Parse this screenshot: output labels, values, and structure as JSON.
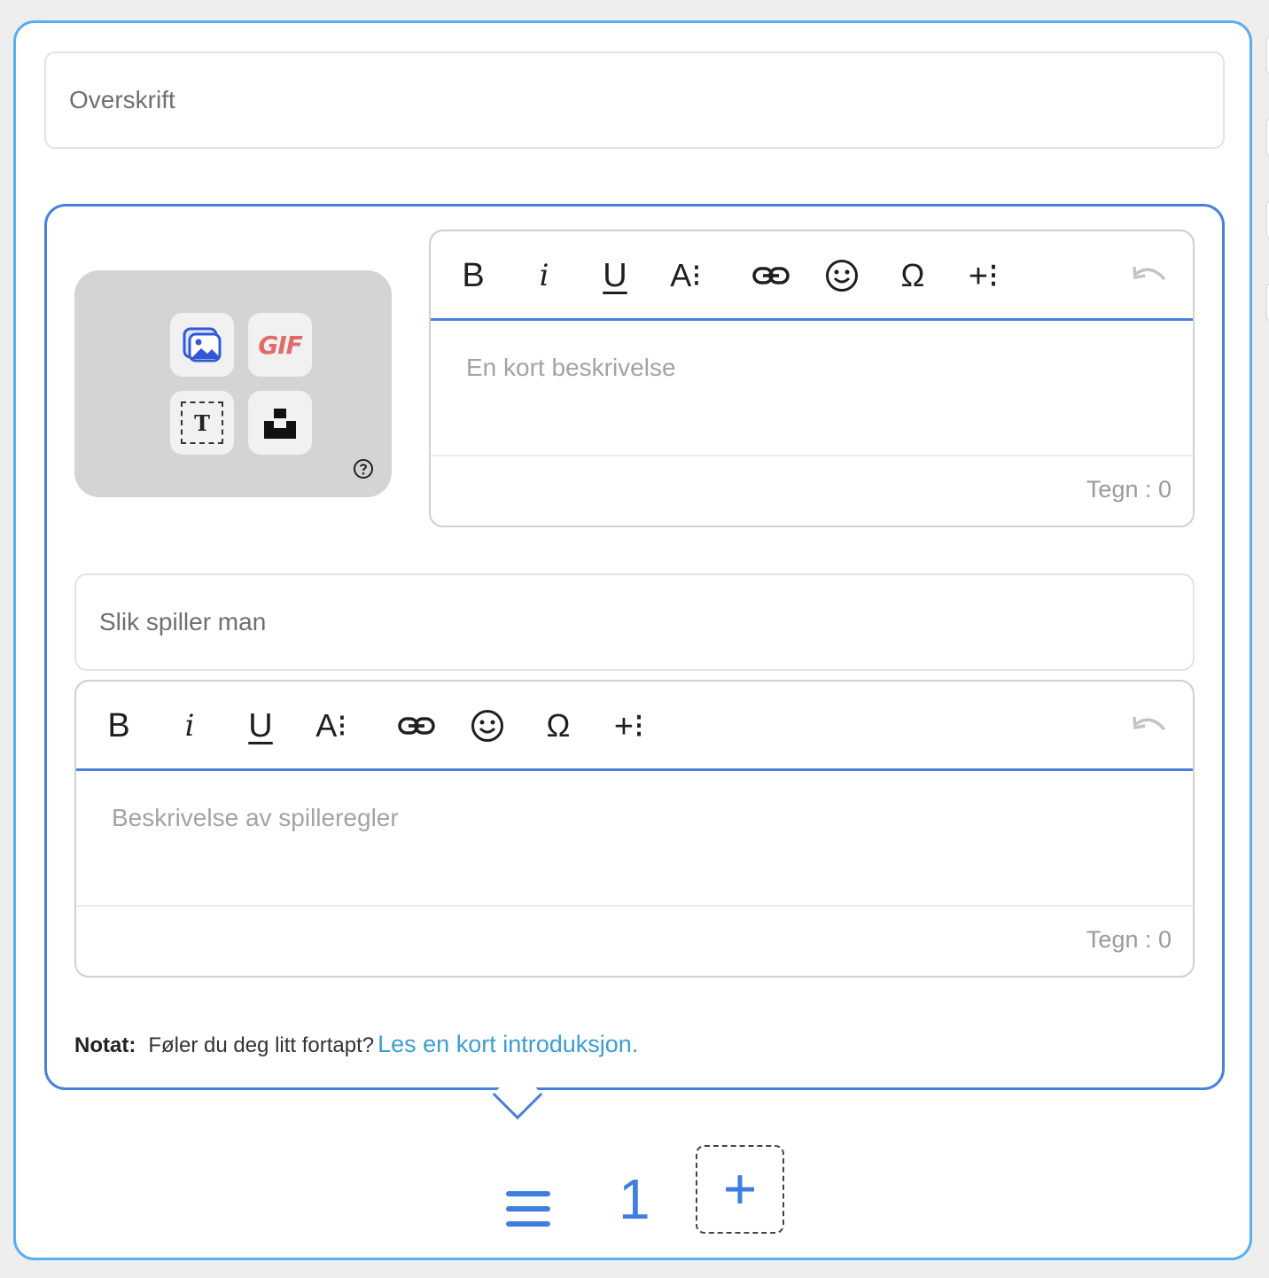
{
  "headline": {
    "placeholder": "Overskrift"
  },
  "media": {
    "image_icon": "image-icon",
    "gif_label": "GIF",
    "text_label": "T",
    "unsplash_icon": "unsplash-icon",
    "help_icon": "help-circle-icon"
  },
  "toolbar": {
    "bold": "B",
    "italic": "i",
    "underline": "U",
    "font_size": "A⁝",
    "link_icon": "link-icon",
    "emoji_icon": "smiley-icon",
    "special_char": "Ω",
    "insert_more": "+⁝",
    "undo_icon": "undo-icon"
  },
  "description_editor": {
    "placeholder": "En kort beskrivelse",
    "counter": "Tegn : 0"
  },
  "rules_section": {
    "title_placeholder": "Slik spiller man",
    "editor_placeholder": "Beskrivelse av spilleregler",
    "counter": "Tegn : 0"
  },
  "note": {
    "label": "Notat:",
    "text": "Føler du deg litt fortapt?",
    "link": "Les en kort introduksjon."
  },
  "slides": {
    "current": "1",
    "add_label": "+"
  },
  "colors": {
    "outer_border": "#5aaef0",
    "inner_border": "#4a80dc",
    "accent": "#3d7ee0",
    "link": "#3b9dd6",
    "gif": "#e26a6a"
  }
}
